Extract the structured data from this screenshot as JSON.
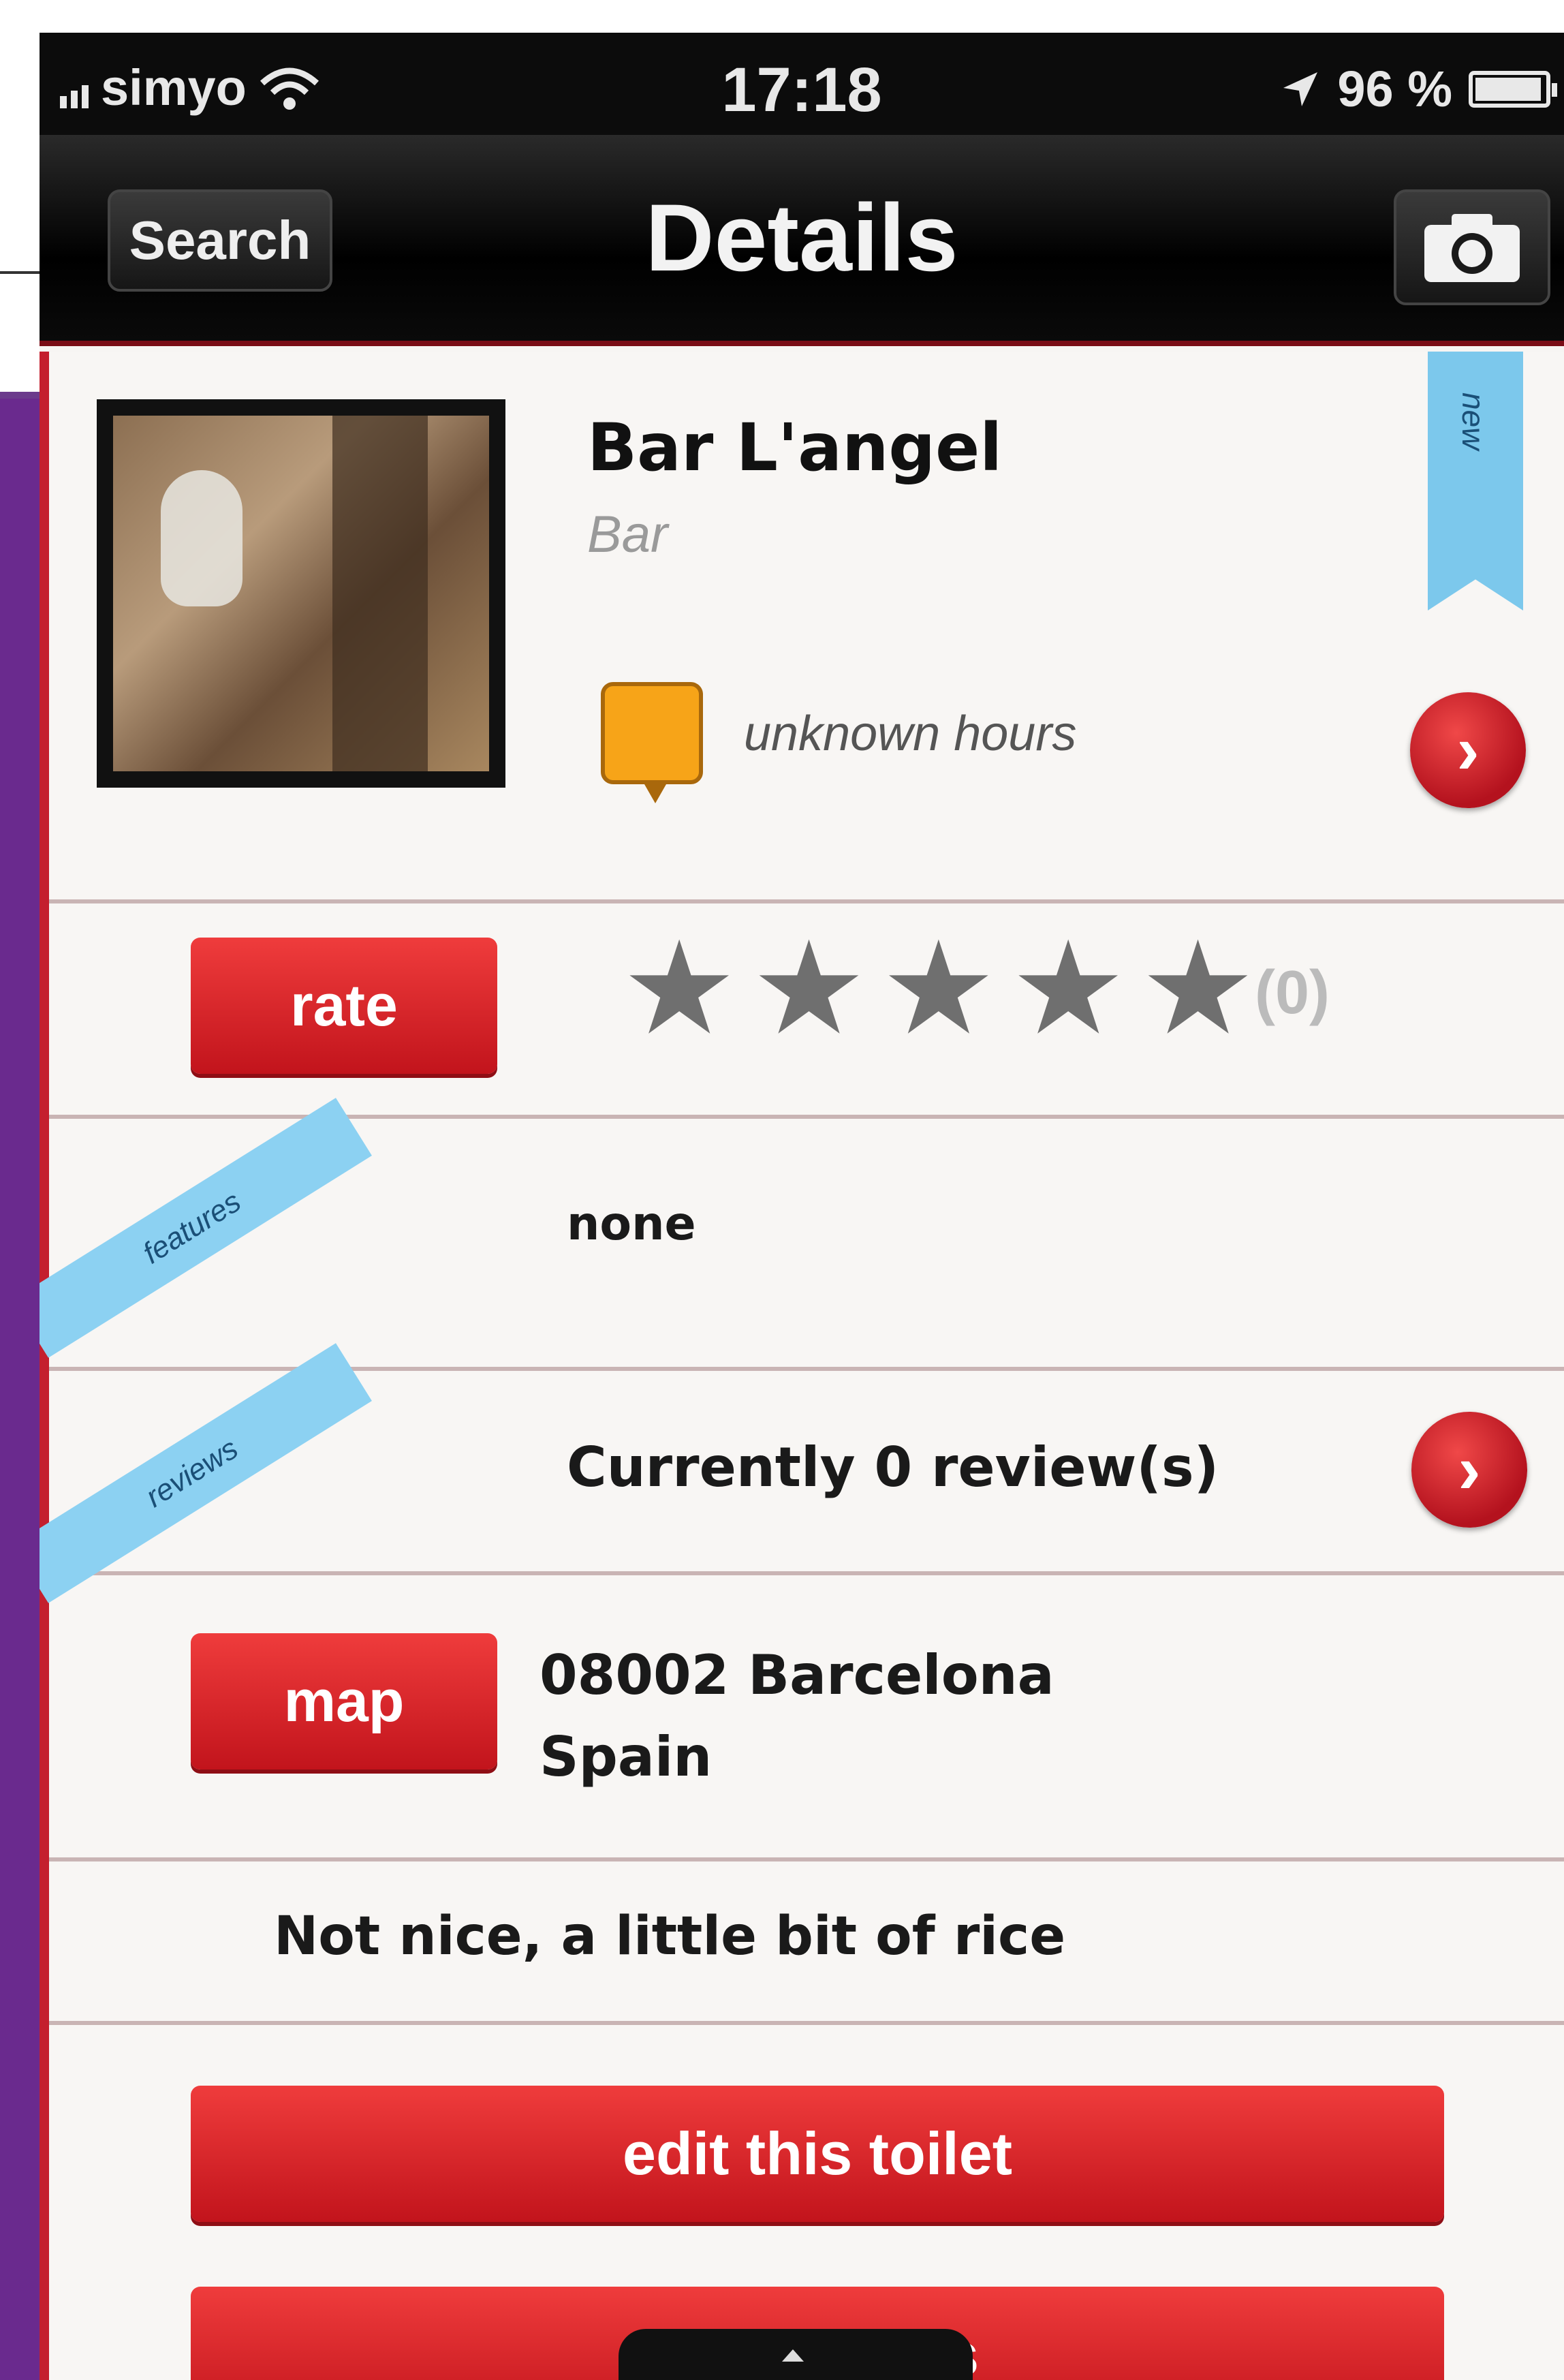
{
  "status_bar": {
    "carrier": "simyo",
    "time": "17:18",
    "battery": "96 %",
    "battery_level": 0.96
  },
  "nav": {
    "back_label": "Search",
    "title": "Details",
    "camera_icon": "camera-icon"
  },
  "place": {
    "name": "Bar L'angel",
    "type": "Bar",
    "ribbon": "new",
    "hours": "unknown hours"
  },
  "rating": {
    "button_label": "rate",
    "stars": 5,
    "stars_filled": 0,
    "count": "(0)"
  },
  "features": {
    "ribbon": "features",
    "value": "none"
  },
  "reviews": {
    "ribbon": "reviews",
    "summary": "Currently 0 review(s)"
  },
  "location": {
    "button_label": "map",
    "address_line1": "08002 Barcelona",
    "address_line2": "Spain"
  },
  "description": "Not nice, a little bit of rice",
  "actions": {
    "edit_label": "edit this toilet",
    "add_label": "add photos"
  },
  "colors": {
    "accent_red": "#c41f2e",
    "ribbon_blue": "#8cd1f2",
    "hours_orange": "#f7a418"
  }
}
